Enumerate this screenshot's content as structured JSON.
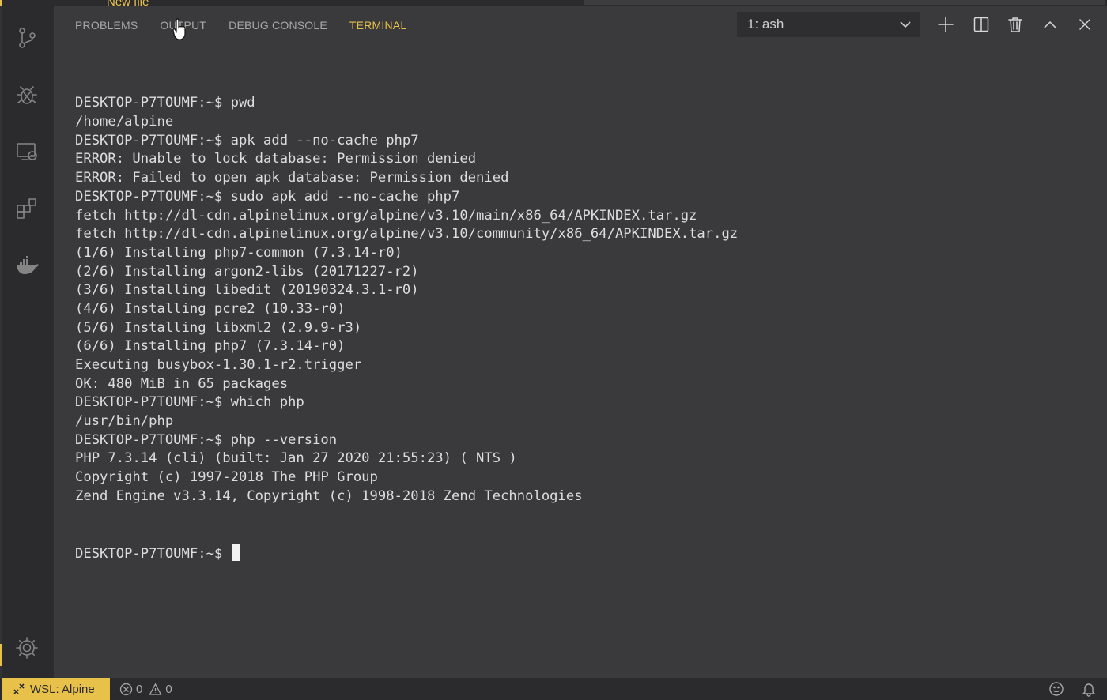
{
  "colors": {
    "accent": "#e8c14a",
    "background": "#3a3a3c",
    "sidebar": "#2b2b2d",
    "text": "#dddddd"
  },
  "editor": {
    "hint": "New file"
  },
  "activity_bar": {
    "icons": [
      "source-control-icon",
      "debug-icon",
      "remote-explorer-icon",
      "extensions-icon",
      "docker-icon",
      "settings-gear-icon"
    ]
  },
  "panel": {
    "tabs": [
      {
        "label": "PROBLEMS",
        "active": false
      },
      {
        "label": "OUTPUT",
        "active": false
      },
      {
        "label": "DEBUG CONSOLE",
        "active": false
      },
      {
        "label": "TERMINAL",
        "active": true
      }
    ],
    "terminal_selector": "1: ash",
    "actions": [
      "add-icon",
      "split-icon",
      "trash-icon",
      "maximize-icon",
      "close-icon"
    ]
  },
  "terminal": {
    "lines": [
      "DESKTOP-P7TOUMF:~$ pwd",
      "/home/alpine",
      "DESKTOP-P7TOUMF:~$ apk add --no-cache php7",
      "ERROR: Unable to lock database: Permission denied",
      "ERROR: Failed to open apk database: Permission denied",
      "DESKTOP-P7TOUMF:~$ sudo apk add --no-cache php7",
      "fetch http://dl-cdn.alpinelinux.org/alpine/v3.10/main/x86_64/APKINDEX.tar.gz",
      "fetch http://dl-cdn.alpinelinux.org/alpine/v3.10/community/x86_64/APKINDEX.tar.gz",
      "(1/6) Installing php7-common (7.3.14-r0)",
      "(2/6) Installing argon2-libs (20171227-r2)",
      "(3/6) Installing libedit (20190324.3.1-r0)",
      "(4/6) Installing pcre2 (10.33-r0)",
      "(5/6) Installing libxml2 (2.9.9-r3)",
      "(6/6) Installing php7 (7.3.14-r0)",
      "Executing busybox-1.30.1-r2.trigger",
      "OK: 480 MiB in 65 packages",
      "DESKTOP-P7TOUMF:~$ which php",
      "/usr/bin/php",
      "DESKTOP-P7TOUMF:~$ php --version",
      "PHP 7.3.14 (cli) (built: Jan 27 2020 21:55:23) ( NTS )",
      "Copyright (c) 1997-2018 The PHP Group",
      "Zend Engine v3.3.14, Copyright (c) 1998-2018 Zend Technologies"
    ],
    "prompt": "DESKTOP-P7TOUMF:~$ "
  },
  "status_bar": {
    "remote": "WSL: Alpine",
    "errors": "0",
    "warnings": "0"
  }
}
